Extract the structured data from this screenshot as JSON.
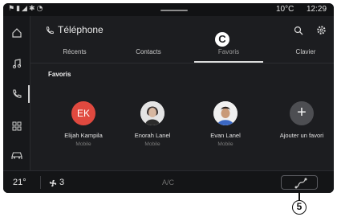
{
  "status": {
    "temperature": "10°C",
    "time": "12:29"
  },
  "header": {
    "title": "Téléphone",
    "marker": "C"
  },
  "tabs": [
    {
      "label": "Récents",
      "active": false
    },
    {
      "label": "Contacts",
      "active": false
    },
    {
      "label": "Favoris",
      "active": true
    },
    {
      "label": "Clavier",
      "active": false
    }
  ],
  "section": {
    "title": "Favoris"
  },
  "favorites": [
    {
      "initials": "EK",
      "name": "Elijah Kampila",
      "type": "Mobile"
    },
    {
      "name": "Enorah Lanel",
      "type": "Mobile"
    },
    {
      "name": "Evan Lanel",
      "type": "Mobile"
    },
    {
      "add_symbol": "+",
      "name": "Ajouter un favori"
    }
  ],
  "climate": {
    "temperature": "21°",
    "fan_level": "3",
    "ac_label": "A/C"
  },
  "callout": "5",
  "colors": {
    "background": "#1c1d20",
    "avatar_initials_bg": "#e0493f",
    "add_button_bg": "#4d4e52"
  }
}
